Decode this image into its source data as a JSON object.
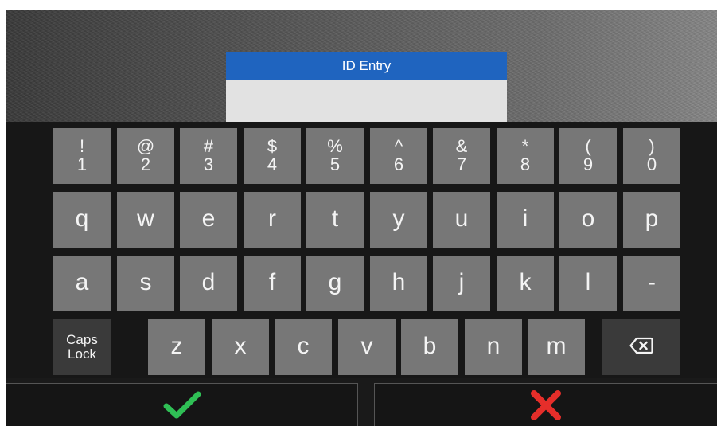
{
  "dialog": {
    "title": "ID Entry",
    "input_value": ""
  },
  "keyboard": {
    "number_row": [
      {
        "sym": "!",
        "digit": "1"
      },
      {
        "sym": "@",
        "digit": "2"
      },
      {
        "sym": "#",
        "digit": "3"
      },
      {
        "sym": "$",
        "digit": "4"
      },
      {
        "sym": "%",
        "digit": "5"
      },
      {
        "sym": "^",
        "digit": "6"
      },
      {
        "sym": "&",
        "digit": "7"
      },
      {
        "sym": "*",
        "digit": "8"
      },
      {
        "sym": "(",
        "digit": "9"
      },
      {
        "sym": ")",
        "digit": "0"
      }
    ],
    "row_q": [
      "q",
      "w",
      "e",
      "r",
      "t",
      "y",
      "u",
      "i",
      "o",
      "p"
    ],
    "row_a": [
      "a",
      "s",
      "d",
      "f",
      "g",
      "h",
      "j",
      "k",
      "l",
      "-"
    ],
    "row_z": [
      "z",
      "x",
      "c",
      "v",
      "b",
      "n",
      "m"
    ],
    "caps_lock": {
      "line1": "Caps",
      "line2": "Lock"
    },
    "backspace_icon": "backspace-icon"
  },
  "actions": {
    "confirm_icon": "checkmark-icon",
    "confirm_color": "#2fbf55",
    "cancel_icon": "x-icon",
    "cancel_color": "#e62e2a"
  },
  "colors": {
    "title_bar": "#1f64bf",
    "key": "#777777",
    "key_dark": "#3a3a3a",
    "keyboard_bg": "#171717"
  }
}
